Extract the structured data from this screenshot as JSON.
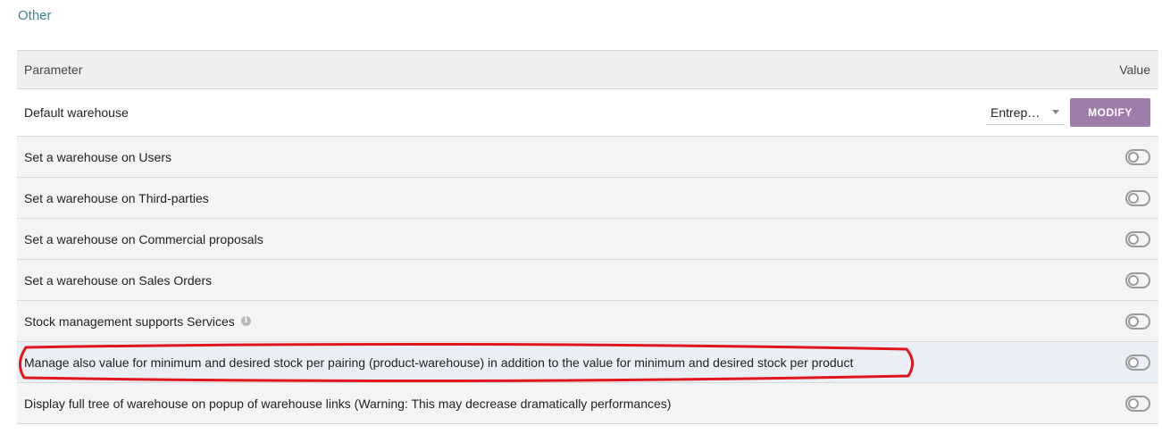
{
  "section": {
    "title": "Other"
  },
  "table": {
    "header": {
      "parameter": "Parameter",
      "value": "Value"
    },
    "default_warehouse": {
      "label": "Default warehouse",
      "select_value": "Entrep…",
      "modify_label": "MODIFY"
    },
    "options": [
      {
        "label": "Set a warehouse on Users",
        "enabled": false
      },
      {
        "label": "Set a warehouse on Third-parties",
        "enabled": false
      },
      {
        "label": "Set a warehouse on Commercial proposals",
        "enabled": false
      },
      {
        "label": "Set a warehouse on Sales Orders",
        "enabled": false
      },
      {
        "label": "Stock management supports Services",
        "enabled": false,
        "has_info_icon": true
      },
      {
        "label": "Manage also value for minimum and desired stock per pairing (product-warehouse) in addition to the value for minimum and desired stock per product",
        "enabled": false,
        "highlighted": true
      },
      {
        "label": "Display full tree of warehouse on popup of warehouse links (Warning: This may decrease dramatically performances)",
        "enabled": false
      }
    ]
  },
  "colors": {
    "accent_title": "#3d8591",
    "modify_button": "#9f7daa",
    "annotation_outline": "#e0161d"
  }
}
